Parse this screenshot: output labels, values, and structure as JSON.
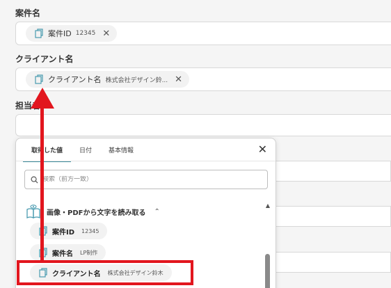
{
  "fields": [
    {
      "label": "案件名",
      "chip": {
        "label": "案件ID",
        "value": "12345"
      }
    },
    {
      "label": "クライアント名",
      "chip": {
        "label": "クライアント名",
        "value": "株式会社デザイン鈴..."
      }
    },
    {
      "label": "担当者"
    }
  ],
  "dropdown": {
    "tabs": [
      "取得した値",
      "日付",
      "基本情報"
    ],
    "active_tab": 0,
    "search_placeholder": "検索（前方一致）",
    "group_title": "画像・PDFから文字を読み取る",
    "items": [
      {
        "label": "案件ID",
        "value": "12345"
      },
      {
        "label": "案件名",
        "value": "LP制作"
      },
      {
        "label": "クライアント名",
        "value": "株式会社デザイン鈴木"
      }
    ]
  },
  "colors": {
    "annotation": "#e2161e",
    "tab_accent": "#3b8b9b"
  },
  "icons": {
    "chip": "document-icon",
    "group": "book-eye-icon",
    "close": "close-icon",
    "search": "search-icon"
  }
}
